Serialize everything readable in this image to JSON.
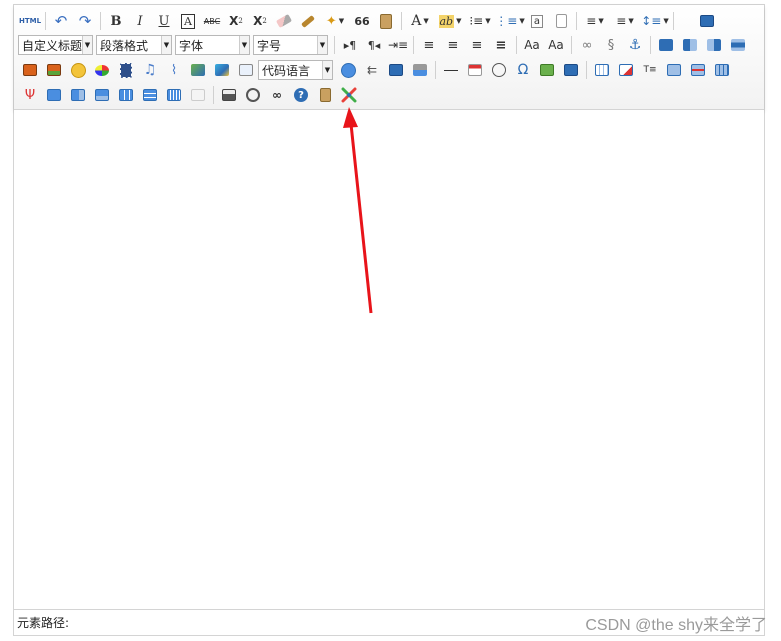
{
  "toolbar": {
    "html_label": "HTML",
    "bold": "B",
    "italic": "I",
    "underline": "U",
    "font_border": "A",
    "strikethrough": "ABC",
    "superscript": "X",
    "subscript": "X",
    "blockquote": "66",
    "fontcolor": "A",
    "highlight": "ab",
    "omega": "Ω",
    "customstyle_value": "自定义标题",
    "paragraph_value": "段落格式",
    "fontfamily_value": "字体",
    "fontsize_value": "字号",
    "codelang_value": "代码语言",
    "ltr": "▸¶",
    "rtl": "¶◂"
  },
  "statusbar": {
    "path_label": "元素路径:"
  },
  "watermark": "CSDN @the shy来全学了",
  "colors": {
    "arrow": "#e8141a",
    "toolbar_bg": "#f5f5f5",
    "border": "#d4d4d4",
    "accent_blue": "#2e6db4"
  }
}
